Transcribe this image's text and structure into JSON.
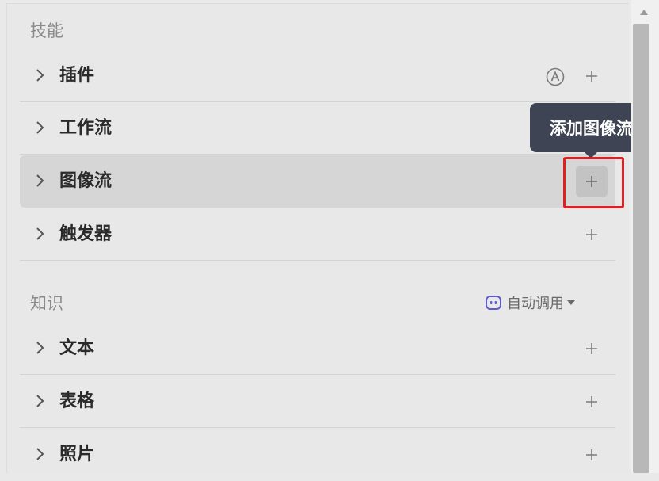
{
  "skills": {
    "title": "技能",
    "items": [
      {
        "label": "插件"
      },
      {
        "label": "工作流"
      },
      {
        "label": "图像流"
      },
      {
        "label": "触发器"
      }
    ]
  },
  "tooltip": {
    "text": "添加图像流"
  },
  "knowledge": {
    "title": "知识",
    "auto_call": "自动调用",
    "items": [
      {
        "label": "文本"
      },
      {
        "label": "表格"
      },
      {
        "label": "照片"
      }
    ]
  },
  "icons": {
    "chevron": "chevron-right-icon",
    "add": "plus-icon",
    "auto": "circled-a-icon",
    "robot": "robot-icon",
    "caret": "caret-down-icon"
  },
  "colors": {
    "tooltip_bg": "#3e4453",
    "highlight": "#e02020",
    "robot_accent": "#5b5bd6"
  }
}
